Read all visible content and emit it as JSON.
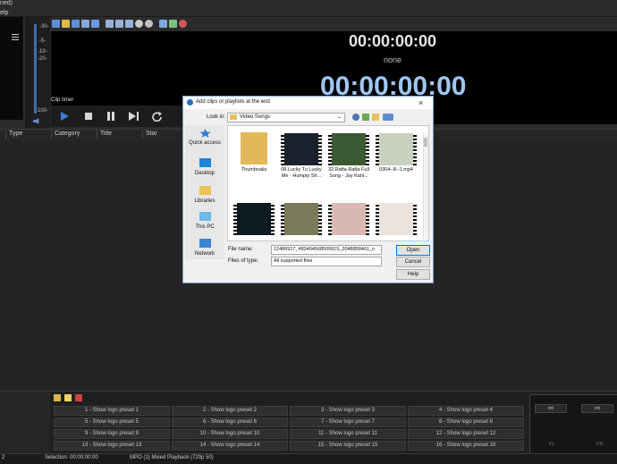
{
  "window": {
    "title_fragment": "ned)",
    "menu_fragment": "elp"
  },
  "meter": {
    "labels": [
      "-30-",
      "-5-",
      "-10-",
      "-20-",
      "-100-"
    ]
  },
  "preview": {
    "timecode_top": "00:00:00:00",
    "state_label": "none",
    "timecode_big": "00:00:00:00",
    "clip_timer_label": "Clip timer"
  },
  "table": {
    "columns": [
      "Type",
      "Category",
      "Title",
      "Star"
    ]
  },
  "dialog": {
    "title": "Add clips or playlists at the end",
    "look_in_label": "Look in:",
    "look_in_value": "Video Songs",
    "places": [
      "Quick access",
      "Desktop",
      "Libraries",
      "This PC",
      "Network"
    ],
    "files": [
      {
        "name": "Thumbnails"
      },
      {
        "name": "08.Lucky Tu Lucky Me - Humpty Sh..."
      },
      {
        "name": "32.Rafta Rafta Full Song - Jay Kahl..."
      },
      {
        "name": "0304--8--1.mp4"
      },
      {
        "name": ""
      },
      {
        "name": ""
      },
      {
        "name": ""
      },
      {
        "name": ""
      }
    ],
    "file_name_label": "File name:",
    "file_name_value": "12486917_483404568509915_2048858461_n",
    "file_type_label": "Files of type:",
    "file_type_value": "All supported files",
    "buttons": {
      "open": "Open",
      "cancel": "Cancel",
      "help": "Help"
    }
  },
  "presets": [
    "1 - Show logo preset 1",
    "2 - Show logo preset 2",
    "3 - Show logo preset 3",
    "4 - Show logo preset 4",
    "5 - Show logo preset 5",
    "6 - Show logo preset 6",
    "7 - Show logo preset 7",
    "8 - Show logo preset 8",
    "9 - Show logo preset 9",
    "10 - Show logo preset 10",
    "11 - Show logo preset 11",
    "12 - Show logo preset 12",
    "13 - Show logo preset 13",
    "14 - Show logo preset 14",
    "15 - Show logo preset 15",
    "16 - Show logo preset 16"
  ],
  "mini_panel": {
    "left_label": "int",
    "right_label": "int",
    "fl_label": "FL",
    "fr_label": "FR"
  },
  "status": {
    "left_value": "2",
    "selection": "Selection: 00:00:00:00",
    "playback": "MPO (1) Mixed Playback (720p 50)"
  },
  "colors": {
    "accent_blue": "#9fc6f0",
    "transport_blue": "#3b7ed8",
    "dialog_border": "#7a9cc6"
  },
  "icons": {
    "transport": [
      "play-icon",
      "stop-icon",
      "pause-icon",
      "skip-next-icon",
      "loop-icon"
    ],
    "toolbar": [
      "new-icon",
      "open-folder-icon",
      "save-icon",
      "edit-icon",
      "grid-icon",
      "settings-icon",
      "list-icon",
      "list2-icon",
      "clock-icon",
      "record-icon",
      "schedule-icon",
      "check-icon",
      "power-icon"
    ]
  }
}
